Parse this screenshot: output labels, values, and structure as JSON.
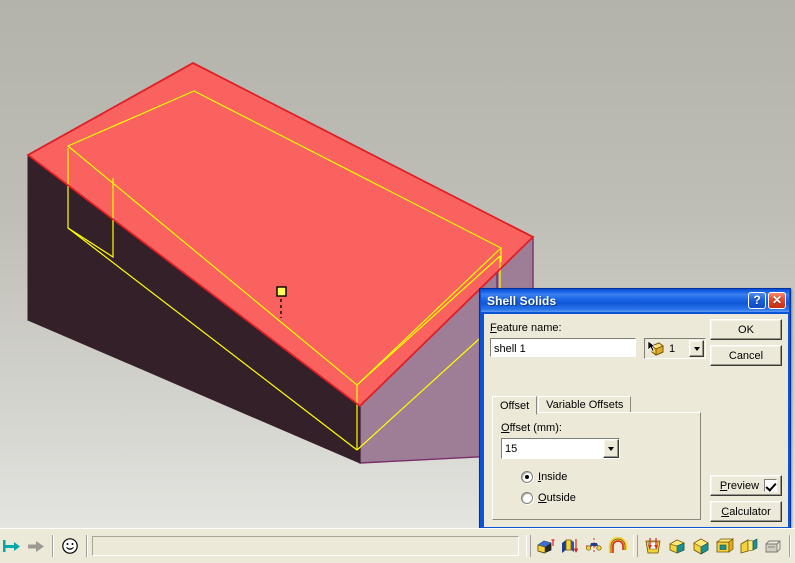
{
  "viewport": {
    "background_top": "#b4b4ac",
    "background_bottom": "#e2e2de",
    "model": {
      "name": "shelled-box-solid",
      "top_face_color": "#f9625f",
      "cavity_color": "#342028",
      "right_face_color": "#9e7e96",
      "edge_color": "#e01e26",
      "highlight_edge_color": "#ffff00",
      "side_edge_color": "#7a2d6b"
    },
    "selected_point_marker": "selection-point-marker"
  },
  "dialog": {
    "title": "Shell Solids",
    "help_button": "?",
    "close_button": "✕",
    "feature_name_label": "Feature name:",
    "feature_name_value": "shell 1",
    "selector_count": "1",
    "selector_icon": "pick-solid-icon",
    "ok_label": "OK",
    "cancel_label": "Cancel",
    "preview_label": "Preview",
    "preview_checked": true,
    "calculator_label": "Calculator",
    "tabs": [
      {
        "label": "Offset",
        "active": true
      },
      {
        "label": "Variable Offsets",
        "active": false
      }
    ],
    "offset_label": "Offset (mm):",
    "offset_value": "15",
    "radios": [
      {
        "label": "Inside",
        "selected": true
      },
      {
        "label": "Outside",
        "selected": false
      }
    ]
  },
  "bottombar": {
    "nav_icons": [
      "previous-feature-icon",
      "next-feature-icon",
      "smiley-face-icon"
    ],
    "status_text": "",
    "tool_icons": [
      "extrude-solid-icon",
      "revolve-solid-icon",
      "sweep-solid-icon",
      "loft-solid-icon",
      "shell-solids-icon",
      "blend-solid-icon",
      "chamfer-solid-icon",
      "boolean-solid-icon",
      "draft-solid-icon",
      "solids-manager-icon"
    ]
  }
}
